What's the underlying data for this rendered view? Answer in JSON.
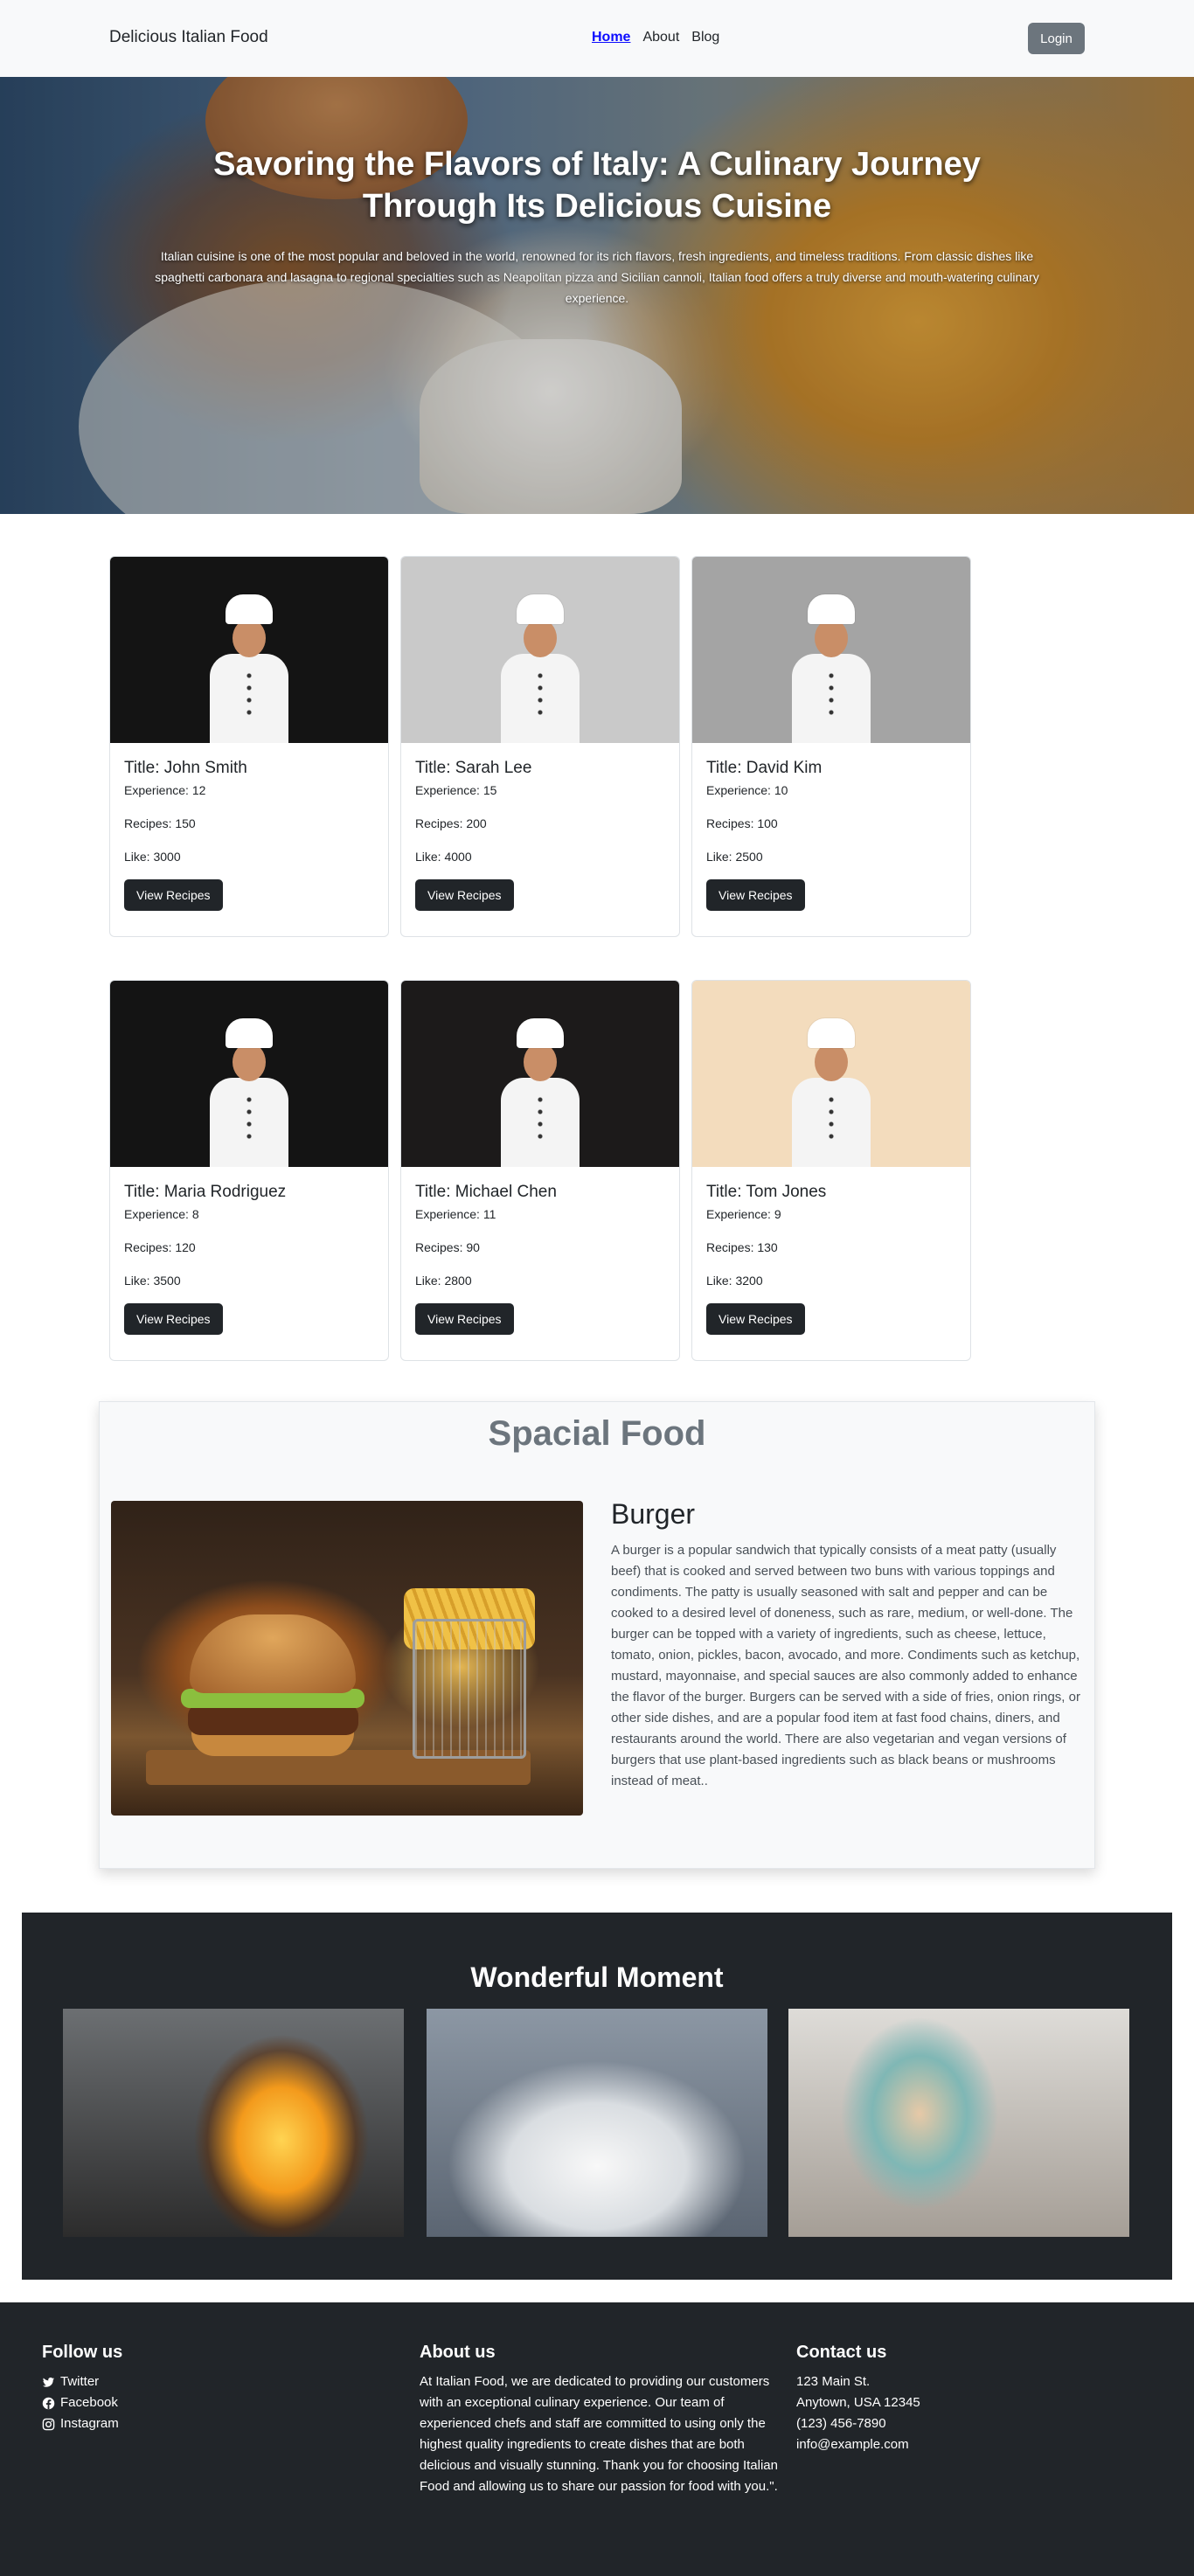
{
  "navbar": {
    "brand": "Delicious Italian Food",
    "links": [
      "Home",
      "About",
      "Blog"
    ],
    "login_label": "Login"
  },
  "hero": {
    "title": "Savoring the Flavors of Italy: A Culinary Journey Through Its Delicious Cuisine",
    "text": "Italian cuisine is one of the most popular and beloved in the world, renowned for its rich flavors, fresh ingredients, and timeless traditions. From classic dishes like spaghetti carbonara and lasagna to regional specialties such as Neapolitan pizza and Sicilian cannoli, Italian food offers a truly diverse and mouth-watering culinary experience."
  },
  "chefs": [
    {
      "title": "Title: John Smith",
      "experience": "Experience: 12",
      "recipes": "Recipes: 150",
      "likes": "Like: 3000",
      "button": "View Recipes",
      "bg": "#141414"
    },
    {
      "title": "Title: Sarah Lee",
      "experience": "Experience: 15",
      "recipes": "Recipes: 200",
      "likes": "Like: 4000",
      "button": "View Recipes",
      "bg": "#c9c9c9"
    },
    {
      "title": "Title: David Kim",
      "experience": "Experience: 10",
      "recipes": "Recipes: 100",
      "likes": "Like: 2500",
      "button": "View Recipes",
      "bg": "#a4a4a4"
    },
    {
      "title": "Title: Maria Rodriguez",
      "experience": "Experience: 8",
      "recipes": "Recipes: 120",
      "likes": "Like: 3500",
      "button": "View Recipes",
      "bg": "#141414"
    },
    {
      "title": "Title: Michael Chen",
      "experience": "Experience: 11",
      "recipes": "Recipes: 90",
      "likes": "Like: 2800",
      "button": "View Recipes",
      "bg": "#1c1a1a"
    },
    {
      "title": "Title: Tom Jones",
      "experience": "Experience: 9",
      "recipes": "Recipes: 130",
      "likes": "Like: 3200",
      "button": "View Recipes",
      "bg": "#f3dcbd"
    }
  ],
  "special": {
    "title": "Spacial Food",
    "heading": "Burger",
    "text": "A burger is a popular sandwich that typically consists of a meat patty (usually beef) that is cooked and served between two buns with various toppings and condiments. The patty is usually seasoned with salt and pepper and can be cooked to a desired level of doneness, such as rare, medium, or well-done. The burger can be topped with a variety of ingredients, such as cheese, lettuce, tomato, onion, pickles, bacon, avocado, and more. Condiments such as ketchup, mustard, mayonnaise, and special sauces are also commonly added to enhance the flavor of the burger. Burgers can be served with a side of fries, onion rings, or other side dishes, and are a popular food item at fast food chains, diners, and restaurants around the world. There are also vegetarian and vegan versions of burgers that use plant-based ingredients such as black beans or mushrooms instead of meat.."
  },
  "moments": {
    "title": "Wonderful Moment"
  },
  "footer": {
    "follow": {
      "heading": "Follow us",
      "items": [
        {
          "label": "Twitter",
          "icon": "twitter-icon"
        },
        {
          "label": "Facebook",
          "icon": "facebook-icon"
        },
        {
          "label": "Instagram",
          "icon": "instagram-icon"
        }
      ]
    },
    "about": {
      "heading": "About us",
      "text": "At Italian Food, we are dedicated to providing our customers with an exceptional culinary experience. Our team of experienced chefs and staff are committed to using only the highest quality ingredients to create dishes that are both delicious and visually stunning. Thank you for choosing Italian Food and allowing us to share our passion for food with you.\"."
    },
    "contact": {
      "heading": "Contact us",
      "lines": [
        "123 Main St.",
        "Anytown, USA 12345",
        "(123) 456-7890",
        "info@example.com"
      ]
    }
  }
}
